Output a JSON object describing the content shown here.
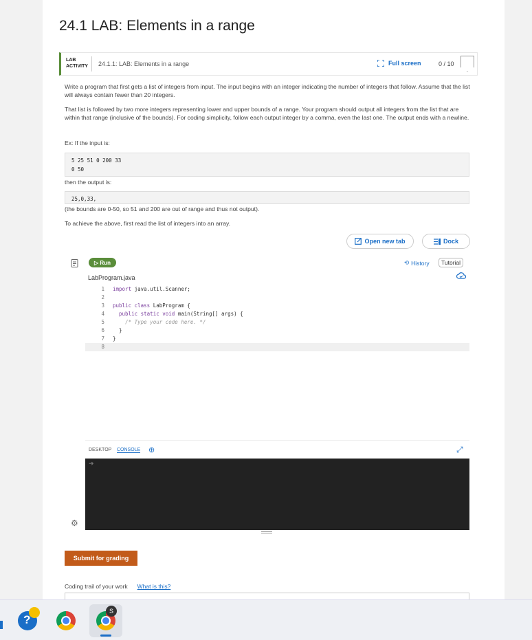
{
  "page": {
    "title": "24.1 LAB: Elements in a range"
  },
  "activity": {
    "tag_line1": "LAB",
    "tag_line2": "ACTIVITY",
    "title": "24.1.1: LAB: Elements in a range",
    "fullscreen_label": "Full screen",
    "score": "0 / 10"
  },
  "description": {
    "p1": "Write a program that first gets a list of integers from input. The input begins with an integer indicating the number of integers that follow. Assume that the list will always contain fewer than 20 integers.",
    "p2": "That list is followed by two more integers representing lower and upper bounds of a range. Your program should output all integers from the list that are within that range (inclusive of the bounds). For coding simplicity, follow each output integer by a comma, even the last one. The output ends with a newline.",
    "ex_label": "Ex: If the input is:",
    "input_line1": "5 25 51 0 200 33",
    "input_line2": "0 50",
    "then_label": "then the output is:",
    "output_line": "25,0,33,",
    "bounds_note": "(the bounds are 0-50, so 51 and 200 are out of range and thus not output).",
    "achieve": "To achieve the above, first read the list of integers into an array."
  },
  "toolbar": {
    "open_new_tab": "Open new tab",
    "dock": "Dock",
    "run": "Run",
    "history": "History",
    "tutorial": "Tutorial"
  },
  "editor": {
    "filename": "LabProgram.java",
    "lines": [
      "import java.util.Scanner;",
      "",
      "public class LabProgram {",
      "   public static void main(String[] args) {",
      "      /* Type your code here. */",
      "   }",
      "}",
      ""
    ]
  },
  "console": {
    "tab_desktop": "DESKTOP",
    "tab_console": "CONSOLE"
  },
  "submit_label": "Submit for grading",
  "trail": {
    "label": "Coding trail of your work",
    "link": "What is this?"
  }
}
